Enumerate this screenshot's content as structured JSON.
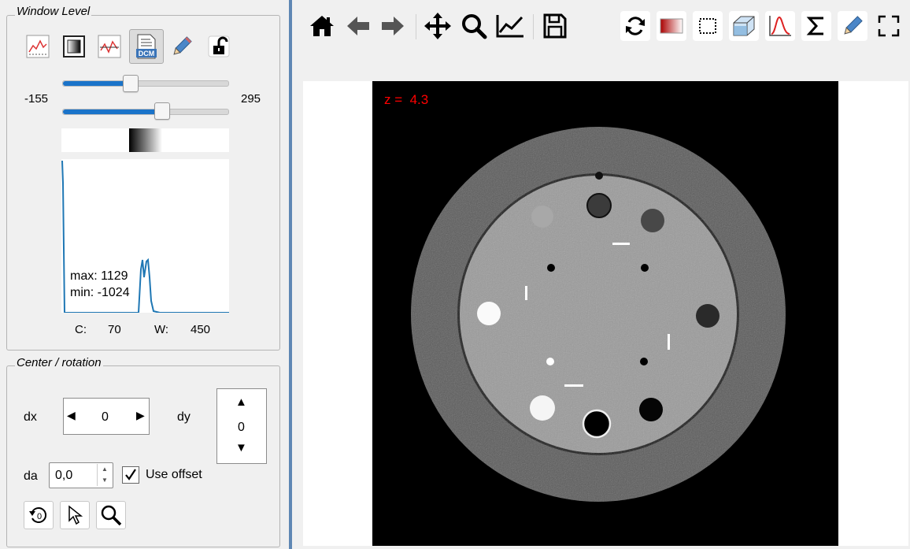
{
  "window_level": {
    "title": "Window Level",
    "min_label": "-155",
    "max_label": "295",
    "slider_low_fraction": 0.41,
    "slider_high_fraction": 0.6,
    "hist_max": "max: 1129",
    "hist_min": "min: -1024",
    "c_label": "C:",
    "c_value": "70",
    "w_label": "W:",
    "w_value": "450",
    "dcm_badge": "DCM"
  },
  "center_rotation": {
    "title": "Center / rotation",
    "dx_label": "dx",
    "dx_value": "0",
    "dy_label": "dy",
    "dy_value": "0",
    "da_label": "da",
    "da_value": "0,0",
    "use_offset_label": "Use offset",
    "use_offset_checked": true,
    "rotate_badge": "0"
  },
  "viewer": {
    "z_label": "z =  4.3",
    "z_color": "#ff0000"
  },
  "colors": {
    "accent": "#1a73c9",
    "divider": "#5f87b4",
    "plot_line": "#1f77b4"
  },
  "icons": {
    "toolbar": [
      "home-icon",
      "back-arrow-icon",
      "forward-arrow-icon",
      "pan-icon",
      "zoom-icon",
      "subplots-icon",
      "save-icon",
      "refresh-icon",
      "colormap-icon",
      "select-rect-icon",
      "cube-icon",
      "curve-icon",
      "sigma-icon",
      "pencil-icon",
      "fullscreen-icon"
    ]
  }
}
